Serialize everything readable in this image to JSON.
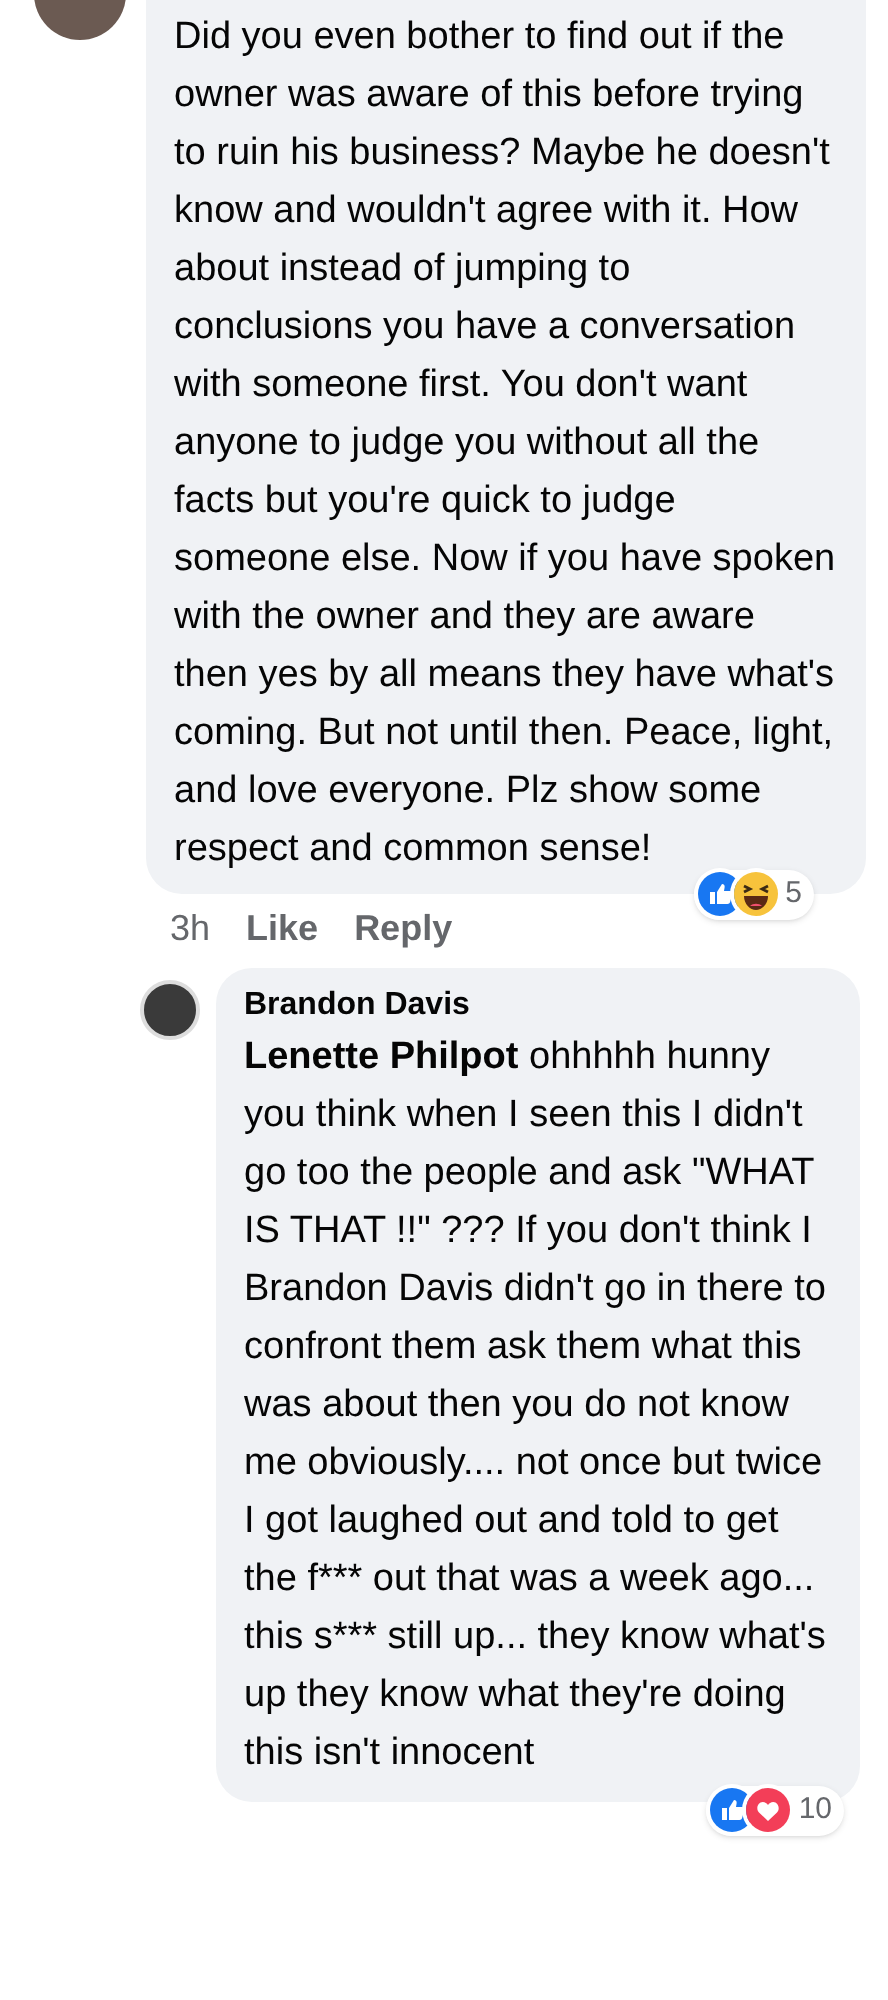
{
  "comments": [
    {
      "text": "Did you even bother to find out if the owner was aware of this before trying to ruin his business? Maybe he doesn't know and wouldn't agree with it. How about instead of jumping to conclusions you have a conversation with someone first. You don't want anyone to judge you without all the facts but you're quick to judge someone else. Now if you have spoken with the owner and they are aware then yes by all means they have what's coming. But not until then. Peace, light, and love everyone. Plz show some respect and common sense!",
      "time": "3h",
      "actions": [
        "Like",
        "Reply"
      ],
      "reactions": [
        {
          "kind": "like"
        },
        {
          "kind": "haha"
        }
      ],
      "reaction_count": "5"
    },
    {
      "author": "Brandon Davis",
      "mention": "Lenette Philpot",
      "text": "ohhhhh hunny you think when I seen this I didn't go too the people and ask \"WHAT IS THAT !!\" ??? If you don't think I Brandon Davis didn't go in there to confront them ask them what this was about then you do not know me obviously.... not once but twice I got laughed out and told to get the f*** out that was a week ago... this s*** still up... they know what's up they know what they're doing this isn't innocent",
      "reactions": [
        {
          "kind": "like"
        },
        {
          "kind": "love"
        }
      ],
      "reaction_count": "10"
    }
  ]
}
